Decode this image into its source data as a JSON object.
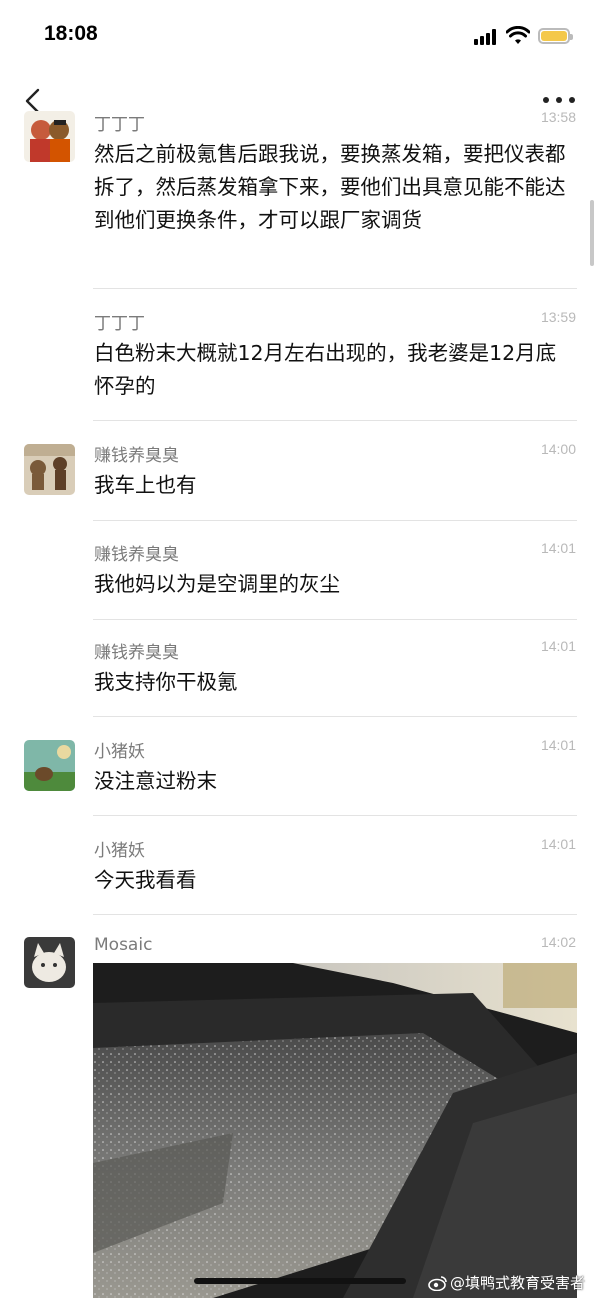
{
  "status_bar": {
    "time": "18:08"
  },
  "messages": [
    {
      "sender": "丁丁丁",
      "time": "13:58",
      "text": "然后之前极氪售后跟我说，要换蒸发箱，要把仪表都拆了，然后蒸发箱拿下来，要他们出具意见能不能达到他们更换条件，才可以跟厂家调货",
      "avatar": "cartoon-avatar"
    },
    {
      "sender": "丁丁丁",
      "time": "13:59",
      "text": "白色粉末大概就12月左右出现的，我老婆是12月底怀孕的"
    },
    {
      "sender": "赚钱养臭臭",
      "time": "14:00",
      "text": "我车上也有",
      "avatar": "bear-avatar"
    },
    {
      "sender": "赚钱养臭臭",
      "time": "14:01",
      "text": "我他妈以为是空调里的灰尘"
    },
    {
      "sender": "赚钱养臭臭",
      "time": "14:01",
      "text": "我支持你干极氪"
    },
    {
      "sender": "小猪妖",
      "time": "14:01",
      "text": "没注意过粉末",
      "avatar": "pig-avatar"
    },
    {
      "sender": "小猪妖",
      "time": "14:01",
      "text": "今天我看看"
    },
    {
      "sender": "Mosaic",
      "time": "14:02",
      "avatar": "cat-avatar",
      "image": "dashboard-white-powder-photo"
    }
  ],
  "watermark": "@填鸭式教育受害者",
  "colors": {
    "name": "#7b7b7b",
    "time": "#b9b9b9",
    "divider": "#e3e3e3",
    "battery": "#f4c84a"
  }
}
